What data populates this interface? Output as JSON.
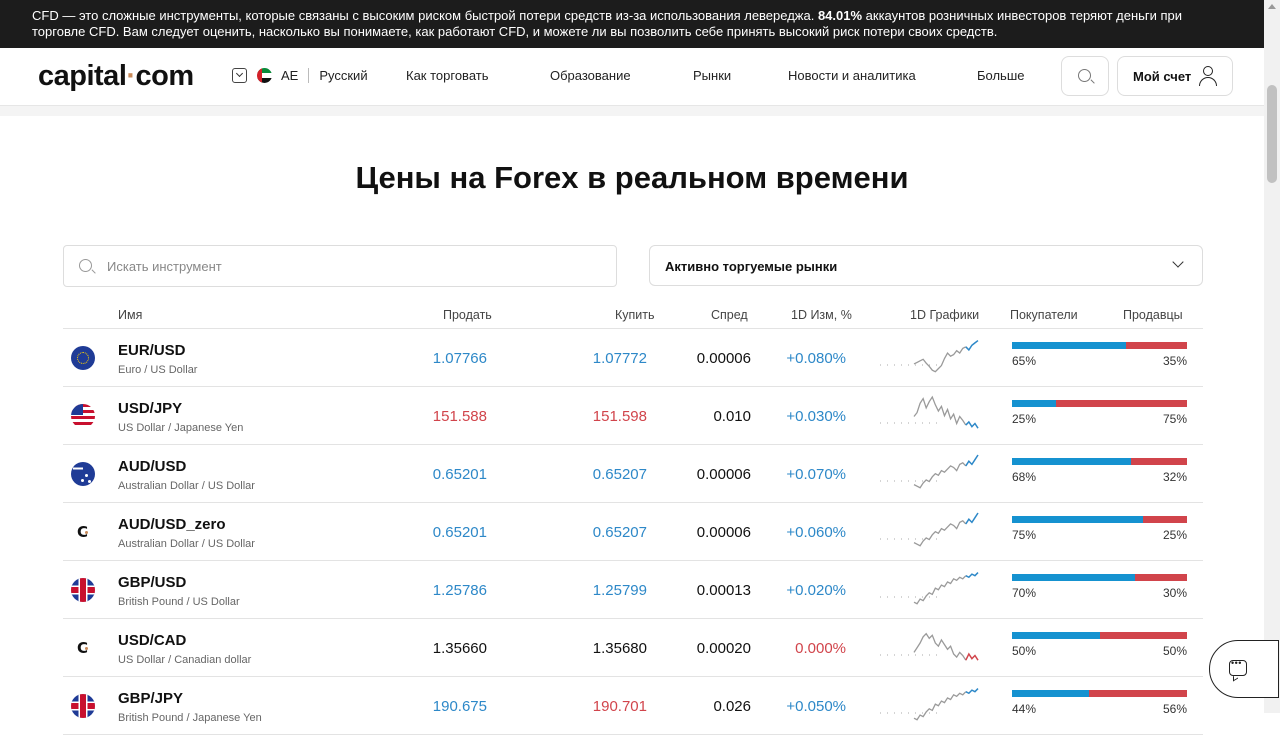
{
  "disclaimer": {
    "text_start": "CFD — это сложные инструменты, которые связаны с высоким риском быстрой потери средств из-за использования левереджа. ",
    "percent": "84.01%",
    "text_end": " аккаунтов розничных инвесторов теряют деньги при торговле CFD. Вам следует оценить, насколько вы понимаете, как работают CFD, и можете ли вы позволить себе принять высокий риск потери своих средств."
  },
  "header": {
    "logo_part1": "capital",
    "logo_dot": "·",
    "logo_part2": "com",
    "region": "AE",
    "language": "Русский",
    "nav": [
      "Как торговать",
      "Образование",
      "Рынки",
      "Новости и аналитика",
      "Больше"
    ],
    "account_label": "Мой счет"
  },
  "page": {
    "title": "Цены на Forex в реальном времени",
    "search_placeholder": "Искать инструмент",
    "market_filter": "Активно торгуемые рынки"
  },
  "table": {
    "headers": {
      "name": "Имя",
      "sell": "Продать",
      "buy": "Купить",
      "spread": "Спред",
      "change": "1D Изм, %",
      "chart": "1D Графики",
      "buyers": "Покупатели",
      "sellers": "Продавцы"
    },
    "rows": [
      {
        "icon": "eu-flag-icon",
        "flag": "eu",
        "symbol": "EUR/USD",
        "desc": "Euro / US Dollar",
        "sell": "1.07766",
        "buy": "1.07772",
        "sell_color": "blue",
        "buy_color": "blue",
        "spread": "0.00006",
        "change": "+0.080%",
        "change_color": "blue",
        "buyers": "65%",
        "sellers": "35%",
        "buyers_pct": 65,
        "spark_end": "blue",
        "spark": [
          48,
          50,
          52,
          54,
          49,
          45,
          40,
          38,
          42,
          46,
          55,
          62,
          58,
          60,
          65,
          62,
          68,
          70,
          66,
          72,
          75,
          78
        ]
      },
      {
        "icon": "us-flag-icon",
        "flag": "us",
        "symbol": "USD/JPY",
        "desc": "US Dollar / Japanese Yen",
        "sell": "151.588",
        "buy": "151.598",
        "sell_color": "red",
        "buy_color": "red",
        "spread": "0.010",
        "change": "+0.030%",
        "change_color": "blue",
        "buyers": "25%",
        "sellers": "75%",
        "buyers_pct": 25,
        "spark_end": "blue",
        "spark": [
          55,
          60,
          72,
          78,
          66,
          74,
          80,
          70,
          62,
          68,
          56,
          64,
          52,
          58,
          46,
          55,
          50,
          44,
          48,
          42,
          46,
          40
        ]
      },
      {
        "icon": "au-flag-icon",
        "flag": "au",
        "symbol": "AUD/USD",
        "desc": "Australian Dollar / US Dollar",
        "sell": "0.65201",
        "buy": "0.65207",
        "sell_color": "blue",
        "buy_color": "blue",
        "spread": "0.00006",
        "change": "+0.070%",
        "change_color": "blue",
        "buyers": "68%",
        "sellers": "32%",
        "buyers_pct": 68,
        "spark_end": "blue",
        "spark": [
          42,
          40,
          38,
          44,
          48,
          46,
          52,
          56,
          54,
          60,
          58,
          62,
          66,
          64,
          60,
          68,
          70,
          66,
          72,
          68,
          74,
          80
        ]
      },
      {
        "icon": "capital-logo-icon",
        "flag": "c",
        "symbol": "AUD/USD_zero",
        "desc": "Australian Dollar / US Dollar",
        "sell": "0.65201",
        "buy": "0.65207",
        "sell_color": "blue",
        "buy_color": "blue",
        "spread": "0.00006",
        "change": "+0.060%",
        "change_color": "blue",
        "buyers": "75%",
        "sellers": "25%",
        "buyers_pct": 75,
        "spark_end": "blue",
        "spark": [
          42,
          40,
          38,
          44,
          48,
          46,
          52,
          56,
          54,
          60,
          58,
          62,
          66,
          64,
          60,
          68,
          70,
          66,
          72,
          68,
          74,
          80
        ]
      },
      {
        "icon": "gb-flag-icon",
        "flag": "gb",
        "symbol": "GBP/USD",
        "desc": "British Pound / US Dollar",
        "sell": "1.25786",
        "buy": "1.25799",
        "sell_color": "blue",
        "buy_color": "blue",
        "spread": "0.00013",
        "change": "+0.020%",
        "change_color": "blue",
        "buyers": "70%",
        "sellers": "30%",
        "buyers_pct": 70,
        "spark_end": "blue",
        "spark": [
          40,
          38,
          44,
          42,
          48,
          52,
          50,
          58,
          56,
          62,
          60,
          66,
          64,
          70,
          68,
          72,
          70,
          74,
          72,
          76,
          74,
          78
        ]
      },
      {
        "icon": "capital-logo-icon",
        "flag": "c",
        "symbol": "USD/CAD",
        "desc": "US Dollar / Canadian dollar",
        "sell": "1.35660",
        "buy": "1.35680",
        "sell_color": "black",
        "buy_color": "black",
        "spread": "0.00020",
        "change": "0.000%",
        "change_color": "red",
        "buyers": "50%",
        "sellers": "50%",
        "buyers_pct": 50,
        "spark_end": "red",
        "spark": [
          50,
          56,
          62,
          70,
          74,
          68,
          72,
          62,
          58,
          66,
          60,
          54,
          58,
          48,
          44,
          50,
          46,
          40,
          48,
          42,
          46,
          40
        ]
      },
      {
        "icon": "gb-flag-icon",
        "flag": "gb",
        "symbol": "GBP/JPY",
        "desc": "British Pound / Japanese Yen",
        "sell": "190.675",
        "buy": "190.701",
        "sell_color": "blue",
        "buy_color": "red",
        "spread": "0.026",
        "change": "+0.050%",
        "change_color": "blue",
        "buyers": "44%",
        "sellers": "56%",
        "buyers_pct": 44,
        "spark_end": "blue",
        "spark": [
          40,
          38,
          44,
          42,
          48,
          52,
          50,
          58,
          56,
          62,
          60,
          66,
          64,
          70,
          68,
          72,
          70,
          74,
          72,
          76,
          74,
          78
        ]
      }
    ]
  },
  "colors": {
    "blue": "#2d88c8",
    "red": "#d1444b",
    "buyers_bar": "#1592d0",
    "sellers_bar": "#d1444b"
  }
}
